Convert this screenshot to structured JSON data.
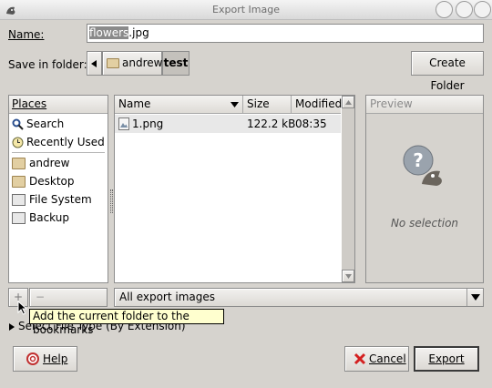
{
  "window": {
    "title": "Export Image"
  },
  "name": {
    "label": "Name:",
    "value_selected": "flowers",
    "value_rest": ".jpg"
  },
  "save_in": {
    "label": "Save in folder:",
    "path": [
      "andrew",
      "test"
    ],
    "create_folder": "Create Folder"
  },
  "places": {
    "header": "Places",
    "items": [
      {
        "label": "Search",
        "icon": "search-icon"
      },
      {
        "label": "Recently Used",
        "icon": "clock-icon"
      },
      {
        "label": "andrew",
        "icon": "folder-icon"
      },
      {
        "label": "Desktop",
        "icon": "folder-icon"
      },
      {
        "label": "File System",
        "icon": "drive-icon"
      },
      {
        "label": "Backup",
        "icon": "drive-icon"
      }
    ],
    "add_button": "+",
    "remove_button": "−"
  },
  "files": {
    "columns": [
      "Name",
      "Size",
      "Modified"
    ],
    "rows": [
      {
        "name": "1.png",
        "size": "122.2 kB",
        "modified": "08:35"
      }
    ]
  },
  "preview": {
    "header": "Preview",
    "status": "No selection"
  },
  "filter": {
    "value": "All export images"
  },
  "tooltip": "Add the current folder to the bookmarks",
  "file_type_expander": "Select File Type (By Extension)",
  "buttons": {
    "help": "Help",
    "cancel": "Cancel",
    "export": "Export"
  },
  "colors": {
    "background": "#d6d3ce",
    "selection": "#8a8a8a",
    "tooltip_bg": "#ffffcf",
    "cancel_icon": "#d42020"
  }
}
